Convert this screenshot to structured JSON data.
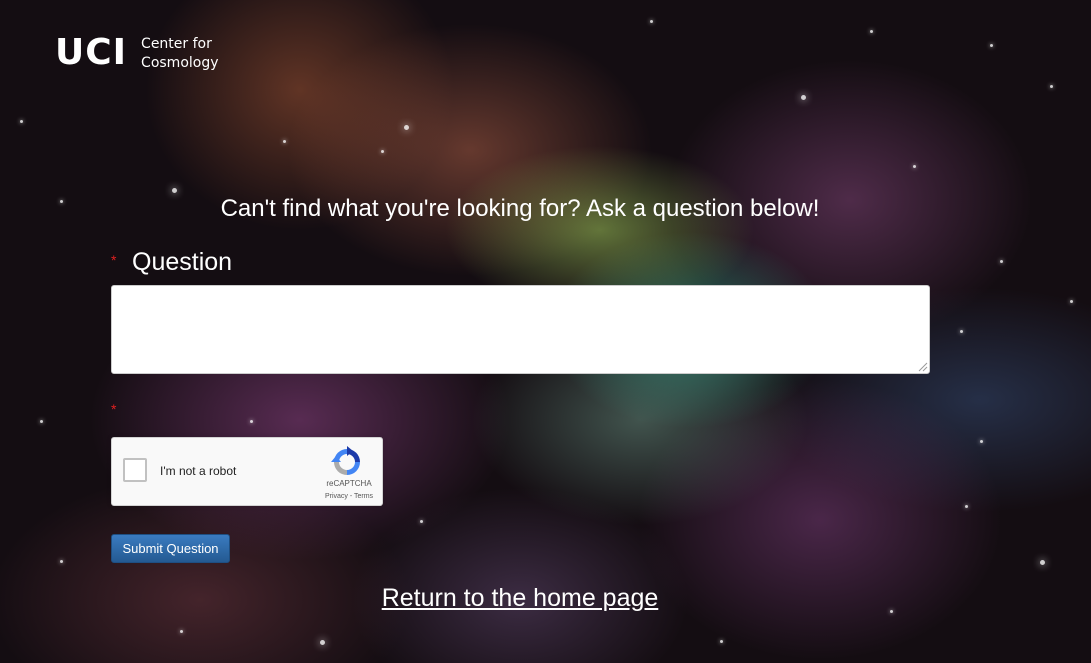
{
  "logo": {
    "mark": "UCI",
    "line1": "Center for",
    "line2": "Cosmology"
  },
  "heading": "Can't find what you're looking for? Ask a question below!",
  "form": {
    "required_marker": "*",
    "question_label": "Question",
    "question_value": "",
    "captcha": {
      "label": "I'm not a robot",
      "brand": "reCAPTCHA",
      "links": "Privacy - Terms",
      "checked": false
    },
    "submit_label": "Submit Question"
  },
  "home_link": "Return to the home page",
  "colors": {
    "required": "#e02020",
    "button": "#2f6aa8",
    "text": "#ffffff"
  },
  "icons": {
    "captcha_logo": "recaptcha-icon",
    "resize_grip": "resize-grip-icon"
  }
}
